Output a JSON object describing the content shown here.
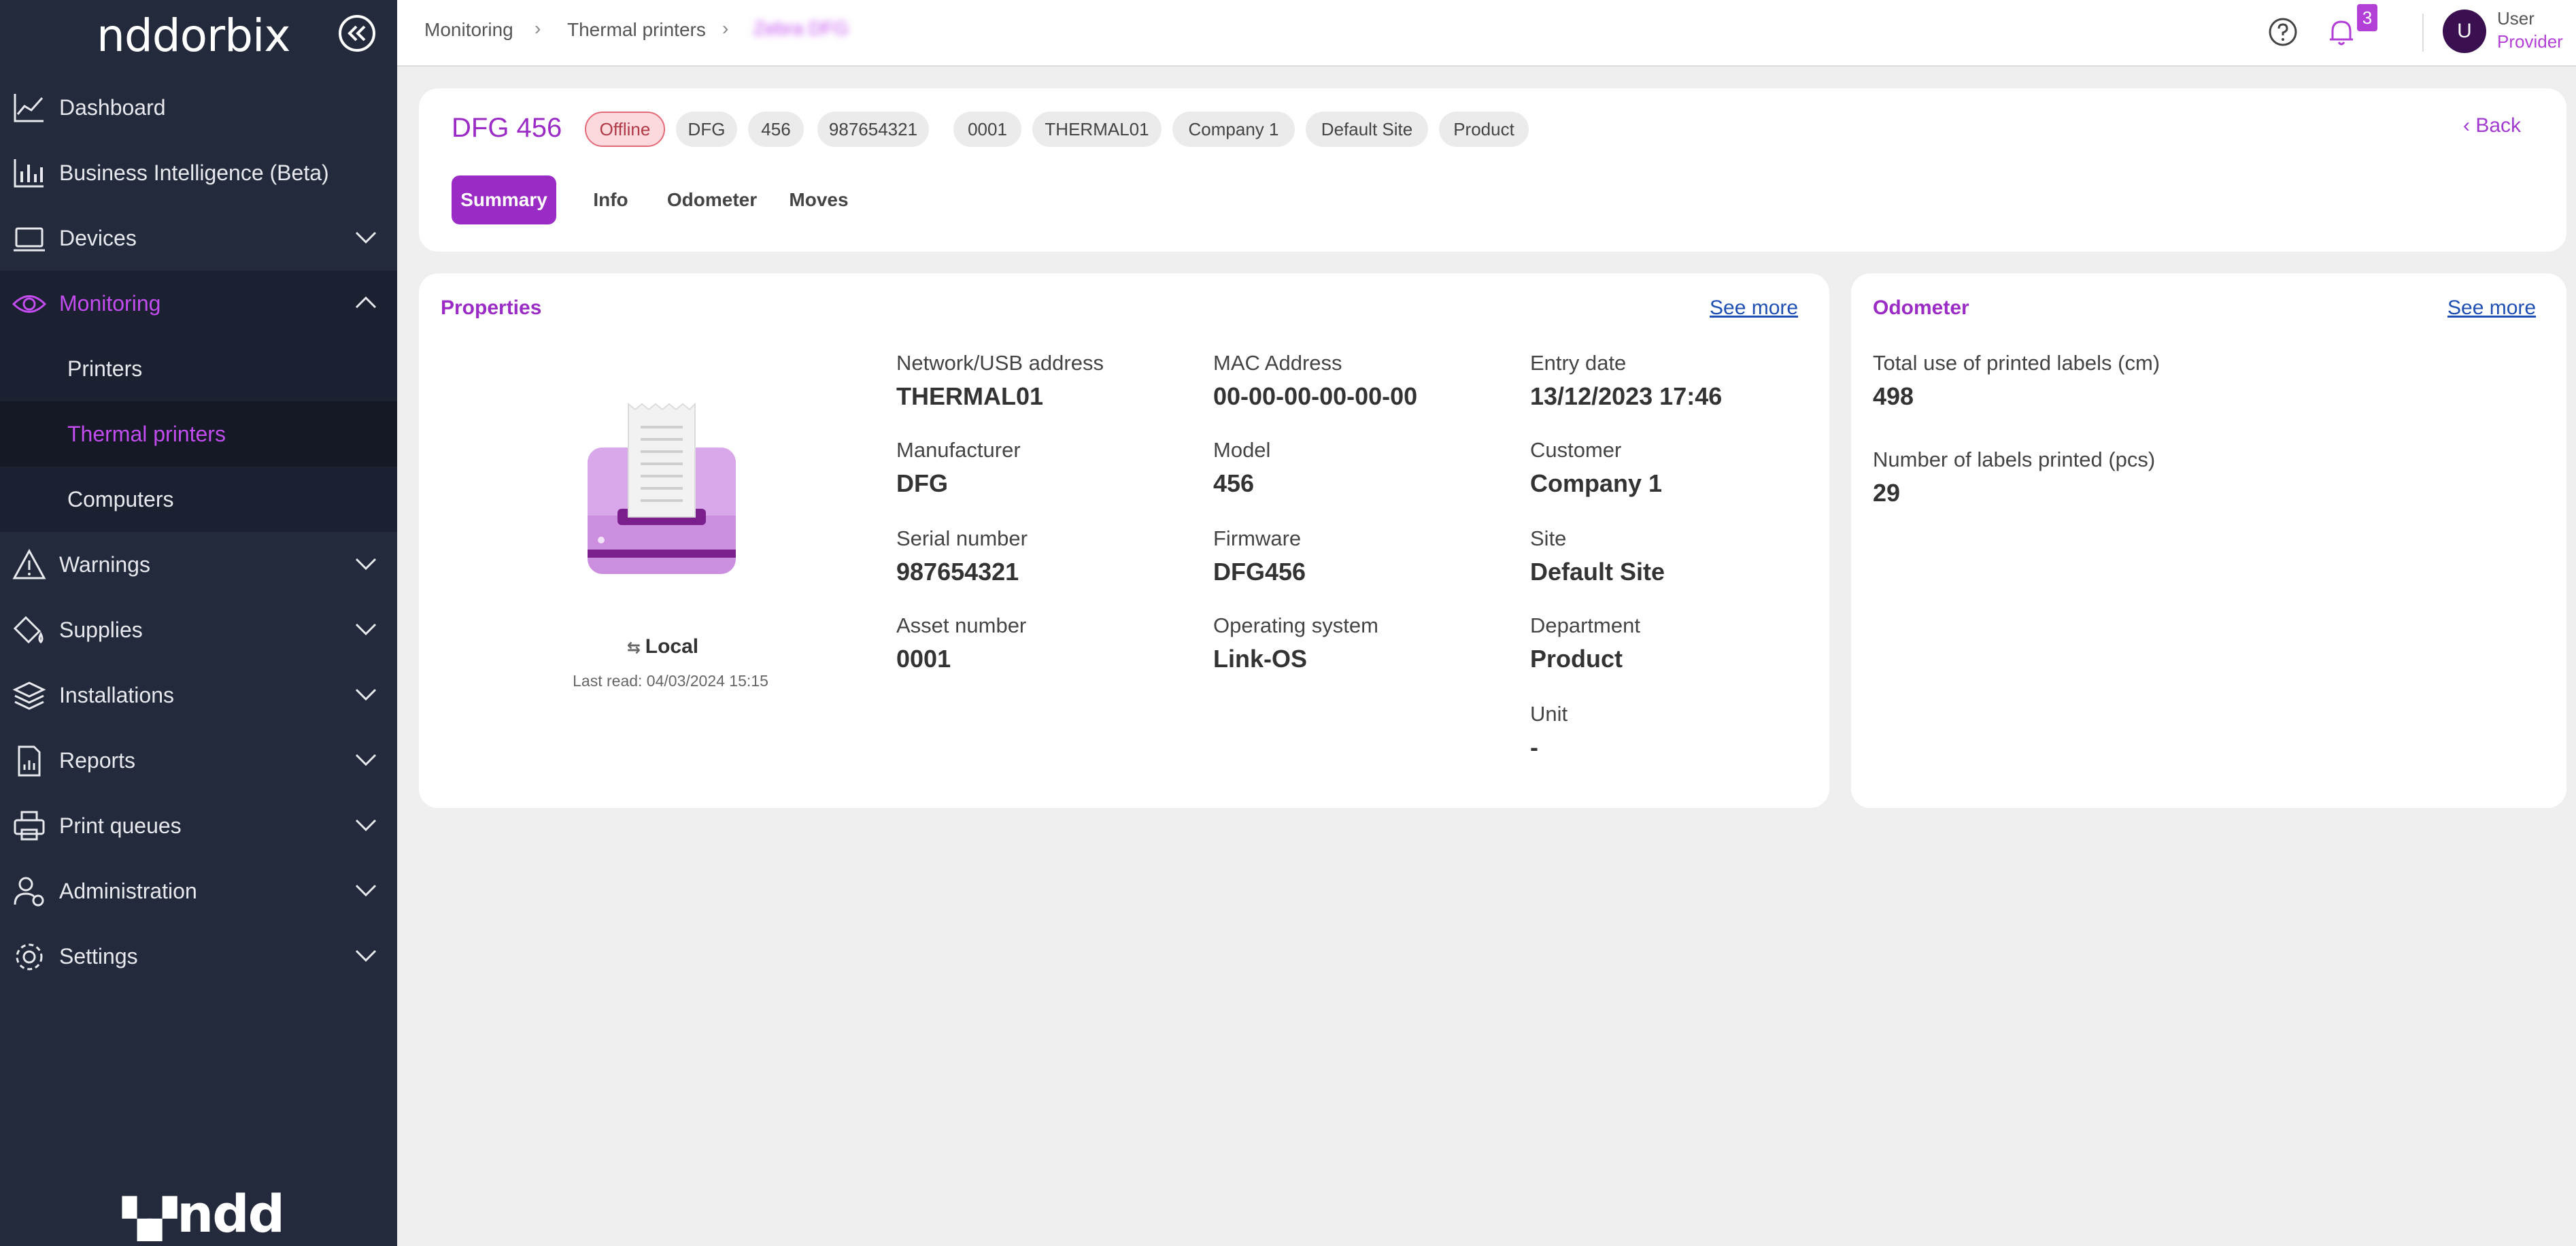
{
  "sidebar": {
    "logo": "nddorbix",
    "bottom_logo_mark": "▚▞",
    "bottom_logo": "ndd",
    "items": [
      {
        "label": "Dashboard"
      },
      {
        "label": "Business Intelligence (Beta)"
      },
      {
        "label": "Devices"
      },
      {
        "label": "Monitoring"
      },
      {
        "label": "Warnings"
      },
      {
        "label": "Supplies"
      },
      {
        "label": "Installations"
      },
      {
        "label": "Reports"
      },
      {
        "label": "Print queues"
      },
      {
        "label": "Administration"
      },
      {
        "label": "Settings"
      }
    ],
    "monitoring_sub": [
      {
        "label": "Printers"
      },
      {
        "label": "Thermal printers"
      },
      {
        "label": "Computers"
      }
    ]
  },
  "topbar": {
    "breadcrumb": [
      "Monitoring",
      "Thermal printers"
    ],
    "breadcrumb_current": "Zebra DFG",
    "notification_count": "3",
    "user_initial": "U",
    "user_name": "User",
    "user_role": "Provider"
  },
  "header": {
    "title": "DFG 456",
    "tags": [
      "Offline",
      "DFG",
      "456",
      "987654321",
      "0001",
      "THERMAL01",
      "Company 1",
      "Default Site",
      "Product"
    ],
    "back_label": "Back",
    "tabs": [
      "Summary",
      "Info",
      "Odometer",
      "Moves"
    ]
  },
  "properties": {
    "title": "Properties",
    "see_more": "See more",
    "connection": "Local",
    "last_read": "Last read: 04/03/2024 15:15",
    "fields": [
      {
        "label": "Network/USB address",
        "value": "THERMAL01"
      },
      {
        "label": "MAC Address",
        "value": "00-00-00-00-00-00"
      },
      {
        "label": "Entry date",
        "value": "13/12/2023 17:46"
      },
      {
        "label": "Manufacturer",
        "value": "DFG"
      },
      {
        "label": "Model",
        "value": "456"
      },
      {
        "label": "Customer",
        "value": "Company 1"
      },
      {
        "label": "Serial number",
        "value": "987654321"
      },
      {
        "label": "Firmware",
        "value": "DFG456"
      },
      {
        "label": "Site",
        "value": "Default Site"
      },
      {
        "label": "Asset number",
        "value": "0001"
      },
      {
        "label": "Operating system",
        "value": "Link-OS"
      },
      {
        "label": "Department",
        "value": "Product"
      },
      {
        "label": "Unit",
        "value": "-"
      }
    ]
  },
  "odometer": {
    "title": "Odometer",
    "see_more": "See more",
    "fields": [
      {
        "label": "Total use of printed labels (cm)",
        "value": "498"
      },
      {
        "label": "Number of labels printed (pcs)",
        "value": "29"
      }
    ]
  },
  "colors": {
    "accent": "#9b2bc5",
    "sidebar_bg": "#232a3b",
    "offline_bg": "#fbd9dc",
    "link": "#1f4fb3"
  }
}
